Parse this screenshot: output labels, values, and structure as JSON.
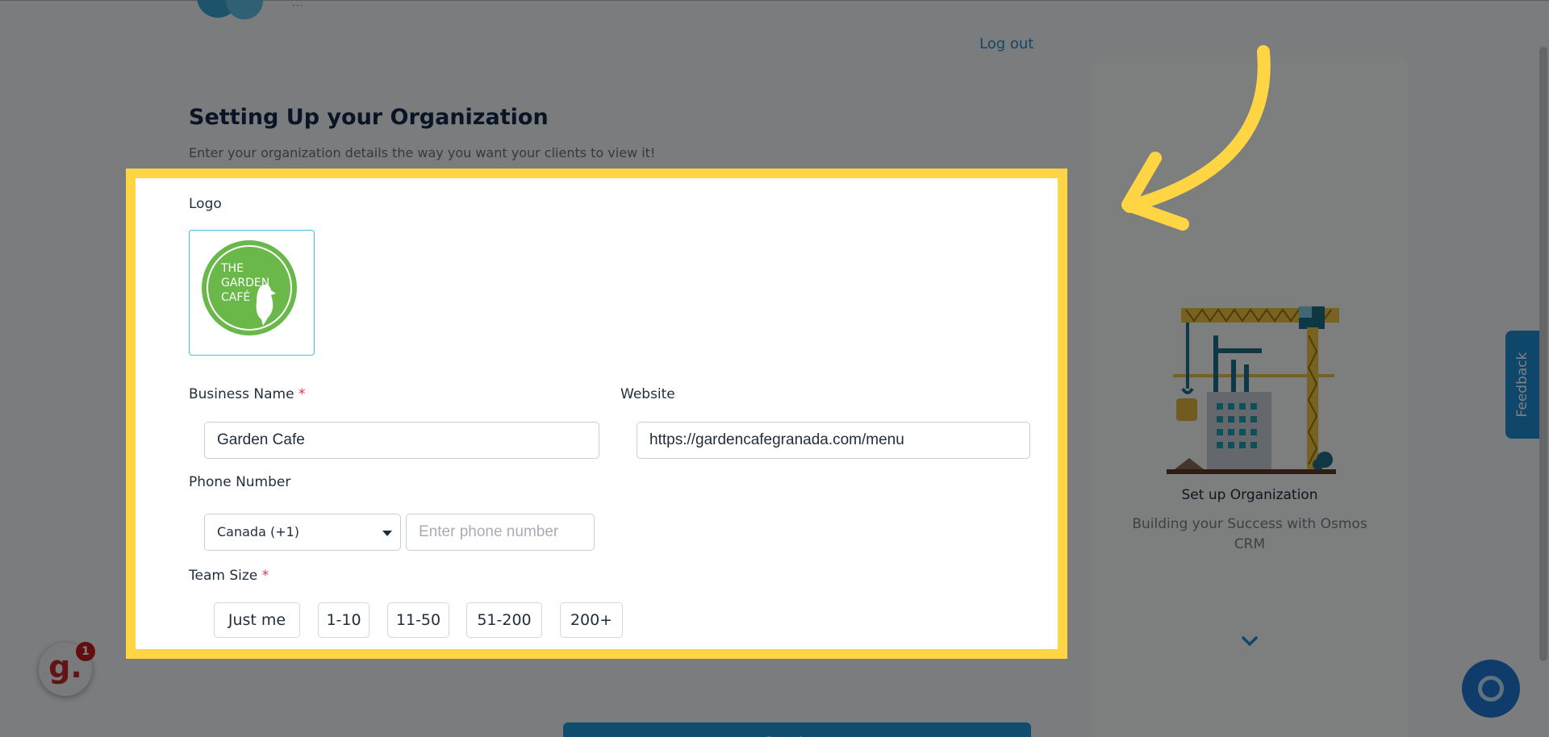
{
  "header": {
    "logout_label": "Log out",
    "brand_dots": "···"
  },
  "page": {
    "title": "Setting Up your Organization",
    "subtitle": "Enter your organization details the way you want your clients to view it!"
  },
  "form": {
    "logo_label": "Logo",
    "logo_text": [
      "THE",
      "GARDEN",
      "CAFÉ"
    ],
    "business_name_label": "Business Name",
    "business_name_value": "Garden Cafe",
    "website_label": "Website",
    "website_value": "https://gardencafegranada.com/menu",
    "phone_label": "Phone Number",
    "country_value": "Canada (+1)",
    "phone_placeholder": "Enter phone number",
    "team_size_label": "Team Size",
    "required_mark": "*",
    "team_sizes": [
      "Just me",
      "1-10",
      "11-50",
      "51-200",
      "200+"
    ]
  },
  "side_panel": {
    "title": "Set up Organization",
    "subtitle": "Building your Success with Osmos CRM"
  },
  "actions": {
    "continue_label": "Continue"
  },
  "widgets": {
    "feedback_label": "Feedback",
    "g_letter": "g.",
    "g_badge_count": "1"
  },
  "colors": {
    "highlight": "#ffd544",
    "accent": "#2198d6",
    "required": "#e0334b",
    "overlay": "rgba(0,0,0,0.5)"
  },
  "icons": [
    "chevron-down-icon",
    "caret-down-icon",
    "chat-icon",
    "arrow-icon",
    "bird-icon"
  ]
}
